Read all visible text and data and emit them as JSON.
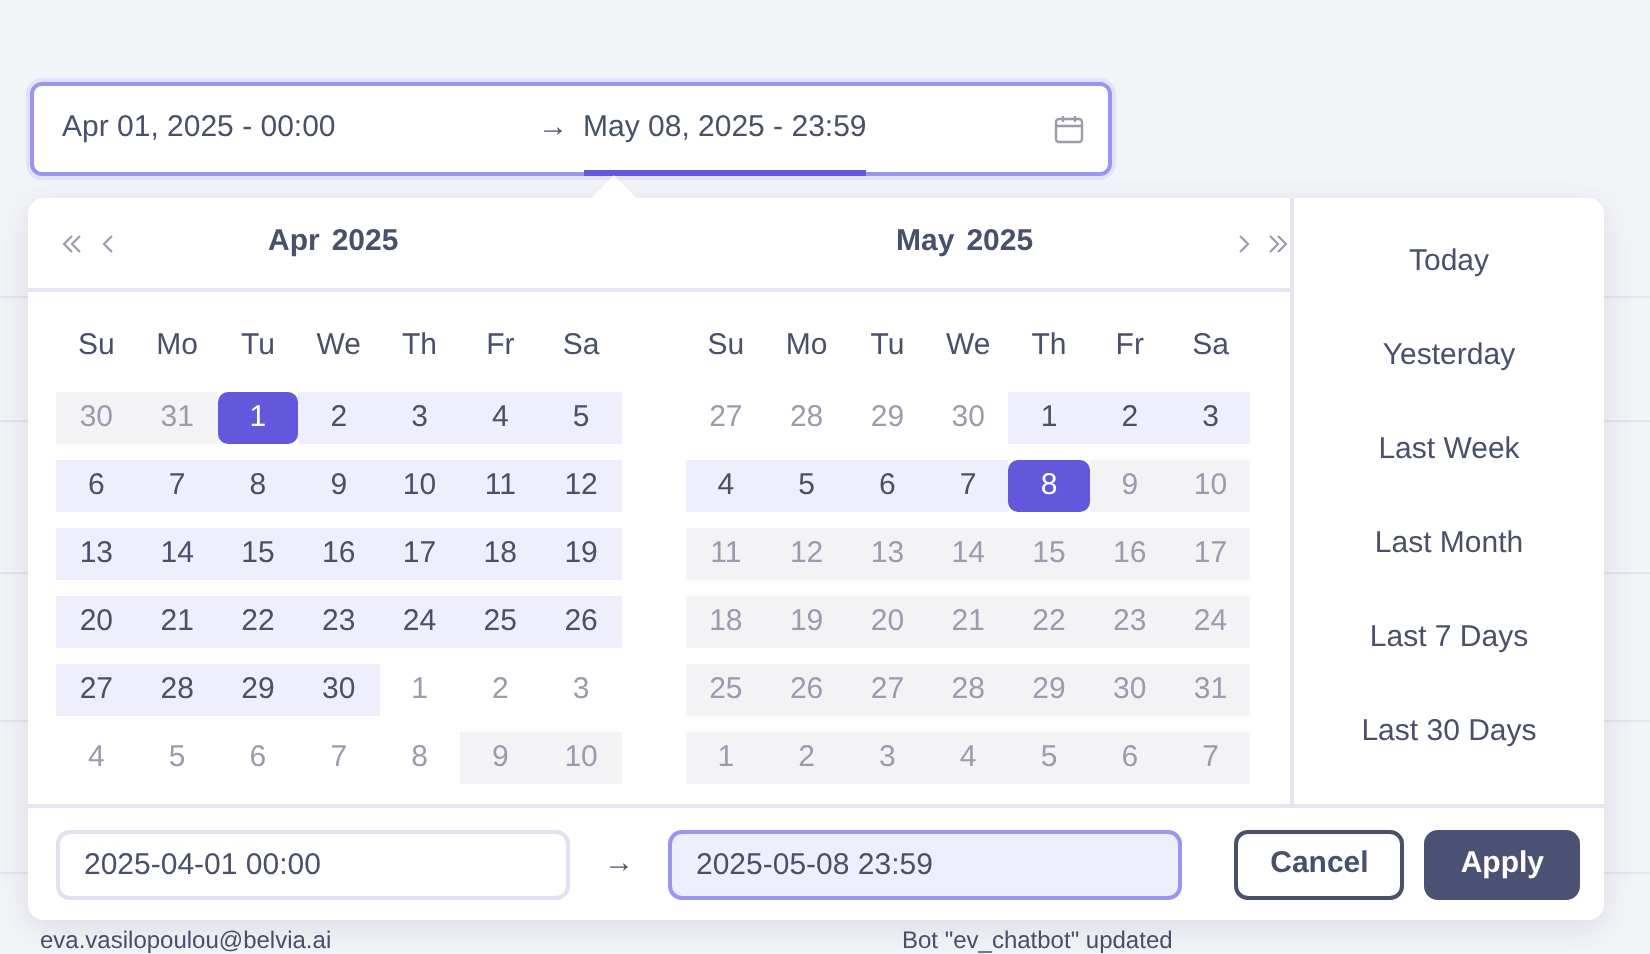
{
  "range_field": {
    "start": {
      "text": "Apr 01, 2025 - 00:00",
      "active": false
    },
    "arrow": "→",
    "end": {
      "text": "May 08, 2025 - 23:59",
      "active": true
    }
  },
  "calendars": [
    {
      "month": "Apr",
      "year": "2025",
      "prev_buttons": true,
      "next_buttons": false,
      "weekdays": [
        "Su",
        "Mo",
        "Tu",
        "We",
        "Th",
        "Fr",
        "Sa"
      ],
      "weeks": [
        [
          {
            "day": "30",
            "kind": "disabled"
          },
          {
            "day": "31",
            "kind": "disabled"
          },
          {
            "day": "1",
            "kind": "selected"
          },
          {
            "day": "2",
            "kind": "range"
          },
          {
            "day": "3",
            "kind": "range"
          },
          {
            "day": "4",
            "kind": "range"
          },
          {
            "day": "5",
            "kind": "range"
          }
        ],
        [
          {
            "day": "6",
            "kind": "range"
          },
          {
            "day": "7",
            "kind": "range"
          },
          {
            "day": "8",
            "kind": "range"
          },
          {
            "day": "9",
            "kind": "range"
          },
          {
            "day": "10",
            "kind": "range"
          },
          {
            "day": "11",
            "kind": "range"
          },
          {
            "day": "12",
            "kind": "range"
          }
        ],
        [
          {
            "day": "13",
            "kind": "range"
          },
          {
            "day": "14",
            "kind": "range"
          },
          {
            "day": "15",
            "kind": "range"
          },
          {
            "day": "16",
            "kind": "range"
          },
          {
            "day": "17",
            "kind": "range"
          },
          {
            "day": "18",
            "kind": "range"
          },
          {
            "day": "19",
            "kind": "range"
          }
        ],
        [
          {
            "day": "20",
            "kind": "range"
          },
          {
            "day": "21",
            "kind": "range"
          },
          {
            "day": "22",
            "kind": "range"
          },
          {
            "day": "23",
            "kind": "range"
          },
          {
            "day": "24",
            "kind": "range"
          },
          {
            "day": "25",
            "kind": "range"
          },
          {
            "day": "26",
            "kind": "range"
          }
        ],
        [
          {
            "day": "27",
            "kind": "range"
          },
          {
            "day": "28",
            "kind": "range"
          },
          {
            "day": "29",
            "kind": "range"
          },
          {
            "day": "30",
            "kind": "range"
          },
          {
            "day": "1",
            "kind": "outside"
          },
          {
            "day": "2",
            "kind": "outside"
          },
          {
            "day": "3",
            "kind": "outside"
          }
        ],
        [
          {
            "day": "4",
            "kind": "outside"
          },
          {
            "day": "5",
            "kind": "outside"
          },
          {
            "day": "6",
            "kind": "outside"
          },
          {
            "day": "7",
            "kind": "outside"
          },
          {
            "day": "8",
            "kind": "outside"
          },
          {
            "day": "9",
            "kind": "disabled"
          },
          {
            "day": "10",
            "kind": "disabled"
          }
        ]
      ]
    },
    {
      "month": "May",
      "year": "2025",
      "prev_buttons": false,
      "next_buttons": true,
      "weekdays": [
        "Su",
        "Mo",
        "Tu",
        "We",
        "Th",
        "Fr",
        "Sa"
      ],
      "weeks": [
        [
          {
            "day": "27",
            "kind": "outside"
          },
          {
            "day": "28",
            "kind": "outside"
          },
          {
            "day": "29",
            "kind": "outside"
          },
          {
            "day": "30",
            "kind": "outside"
          },
          {
            "day": "1",
            "kind": "range"
          },
          {
            "day": "2",
            "kind": "range"
          },
          {
            "day": "3",
            "kind": "range"
          }
        ],
        [
          {
            "day": "4",
            "kind": "range"
          },
          {
            "day": "5",
            "kind": "range"
          },
          {
            "day": "6",
            "kind": "range"
          },
          {
            "day": "7",
            "kind": "range"
          },
          {
            "day": "8",
            "kind": "selected"
          },
          {
            "day": "9",
            "kind": "disabled"
          },
          {
            "day": "10",
            "kind": "disabled"
          }
        ],
        [
          {
            "day": "11",
            "kind": "disabled"
          },
          {
            "day": "12",
            "kind": "disabled"
          },
          {
            "day": "13",
            "kind": "disabled"
          },
          {
            "day": "14",
            "kind": "disabled"
          },
          {
            "day": "15",
            "kind": "disabled"
          },
          {
            "day": "16",
            "kind": "disabled"
          },
          {
            "day": "17",
            "kind": "disabled"
          }
        ],
        [
          {
            "day": "18",
            "kind": "disabled"
          },
          {
            "day": "19",
            "kind": "disabled"
          },
          {
            "day": "20",
            "kind": "disabled"
          },
          {
            "day": "21",
            "kind": "disabled"
          },
          {
            "day": "22",
            "kind": "disabled"
          },
          {
            "day": "23",
            "kind": "disabled"
          },
          {
            "day": "24",
            "kind": "disabled"
          }
        ],
        [
          {
            "day": "25",
            "kind": "disabled"
          },
          {
            "day": "26",
            "kind": "disabled"
          },
          {
            "day": "27",
            "kind": "disabled"
          },
          {
            "day": "28",
            "kind": "disabled"
          },
          {
            "day": "29",
            "kind": "disabled"
          },
          {
            "day": "30",
            "kind": "disabled"
          },
          {
            "day": "31",
            "kind": "disabled"
          }
        ],
        [
          {
            "day": "1",
            "kind": "disabled"
          },
          {
            "day": "2",
            "kind": "disabled"
          },
          {
            "day": "3",
            "kind": "disabled"
          },
          {
            "day": "4",
            "kind": "disabled"
          },
          {
            "day": "5",
            "kind": "disabled"
          },
          {
            "day": "6",
            "kind": "disabled"
          },
          {
            "day": "7",
            "kind": "disabled"
          }
        ]
      ]
    }
  ],
  "presets": [
    "Today",
    "Yesterday",
    "Last Week",
    "Last Month",
    "Last 7 Days",
    "Last 30 Days"
  ],
  "footer": {
    "start": {
      "value": "2025-04-01 00:00",
      "focused": false
    },
    "arrow": "→",
    "end": {
      "value": "2025-05-08 23:59",
      "focused": true
    },
    "buttons": [
      {
        "label": "Cancel",
        "kind": "secondary"
      },
      {
        "label": "Apply",
        "kind": "primary"
      }
    ]
  },
  "background_row": {
    "user": "eva.vasilopoulou@belvia.ai",
    "action": "Bot \"ev_chatbot\" updated"
  }
}
